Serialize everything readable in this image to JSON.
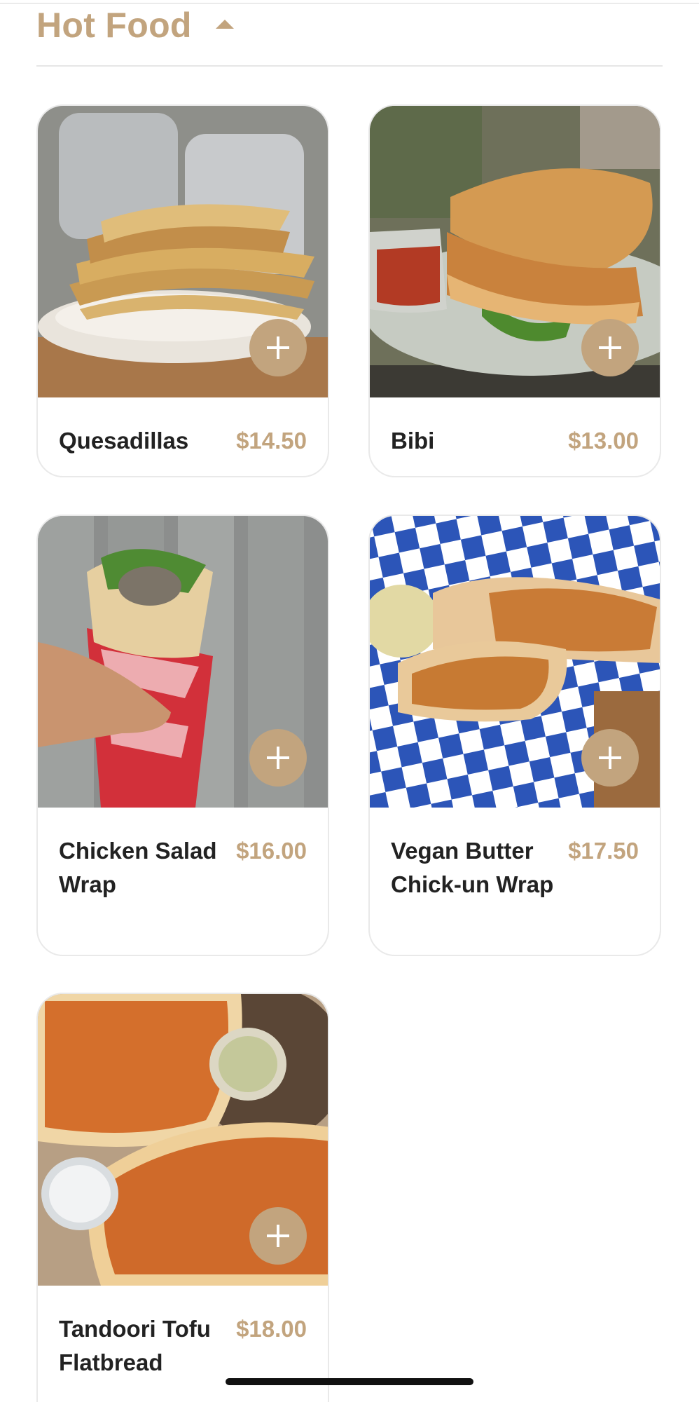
{
  "section": {
    "title": "Hot Food"
  },
  "colors": {
    "accent": "#c2a47e",
    "text": "#222222",
    "card_border": "#e9e9e9"
  },
  "icons": {
    "toggle": "caret-up-icon",
    "add": "plus-icon"
  },
  "items": [
    {
      "name": "Quesadillas",
      "price": "$14.50"
    },
    {
      "name": "Bibi",
      "price": "$13.00"
    },
    {
      "name": "Chicken Salad Wrap",
      "price": "$16.00"
    },
    {
      "name": "Vegan Butter Chick-un Wrap",
      "price": "$17.50"
    },
    {
      "name": "Tandoori Tofu Flatbread",
      "price": "$18.00"
    }
  ]
}
